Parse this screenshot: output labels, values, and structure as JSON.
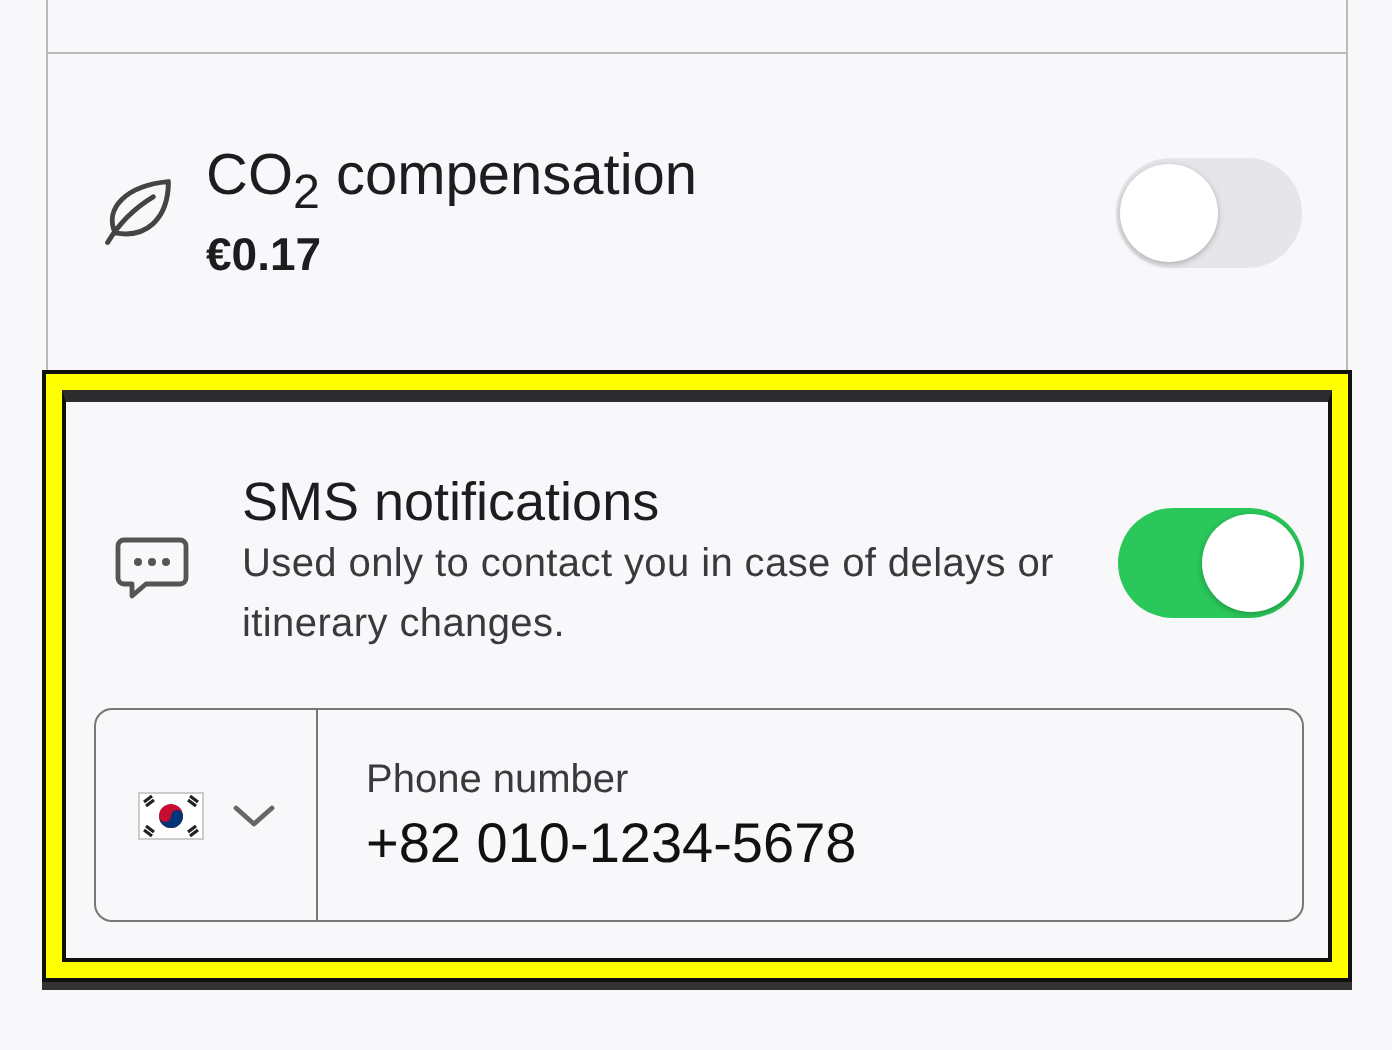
{
  "co2": {
    "title": "CO$_{2}$ compensation",
    "price": "€0.17",
    "on": false
  },
  "sms": {
    "title": "SMS notifications",
    "description": "Used only to contact you in case of delays or itinerary changes.",
    "on": true
  },
  "phone": {
    "label": "Phone number",
    "value": "+82 010-1234-5678"
  }
}
